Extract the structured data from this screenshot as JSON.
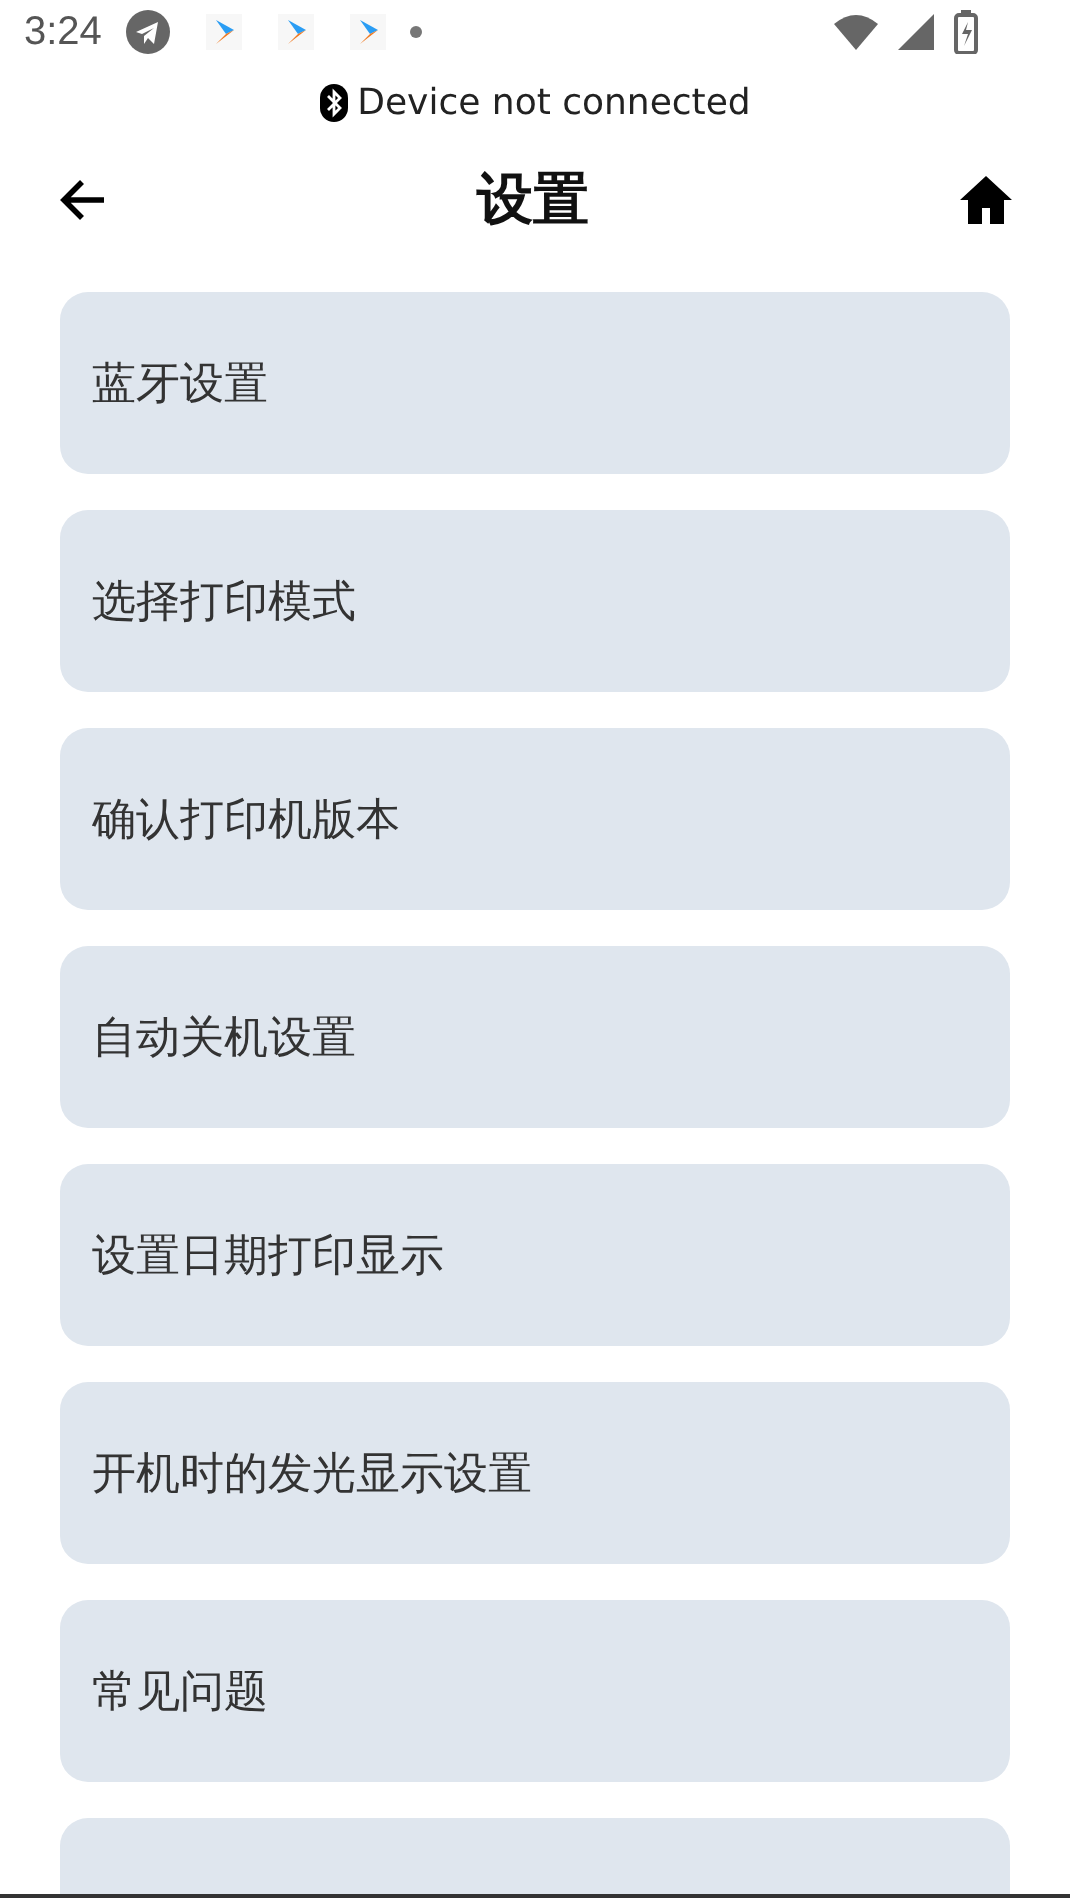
{
  "status_bar": {
    "time": "3:24",
    "notification_icons": [
      {
        "kind": "telegram"
      },
      {
        "kind": "app"
      },
      {
        "kind": "app"
      },
      {
        "kind": "app"
      },
      {
        "kind": "dot"
      }
    ]
  },
  "connection": {
    "text": "Device not connected"
  },
  "header": {
    "title": "设置"
  },
  "items": [
    {
      "label": "蓝牙设置"
    },
    {
      "label": "选择打印模式"
    },
    {
      "label": "确认打印机版本"
    },
    {
      "label": "自动关机设置"
    },
    {
      "label": "设置日期打印显示"
    },
    {
      "label": "开机时的发光显示设置"
    },
    {
      "label": "常见问题"
    },
    {
      "kind": "cut_off"
    }
  ]
}
